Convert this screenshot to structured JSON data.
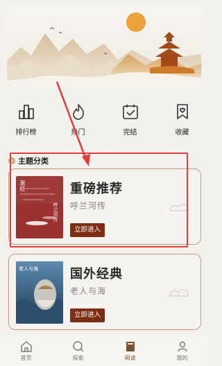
{
  "quick_nav": [
    {
      "label": "排行榜",
      "icon": "bar-chart-icon"
    },
    {
      "label": "热门",
      "icon": "flame-icon"
    },
    {
      "label": "完结",
      "icon": "calendar-check-icon"
    },
    {
      "label": "收藏",
      "icon": "bookmark-heart-icon"
    }
  ],
  "section": {
    "title": "主题分类"
  },
  "cards": [
    {
      "title": "重磅推荐",
      "subtitle": "呼兰河传",
      "cover_title": "呼兰河传",
      "cover_label": "萧红",
      "button": "立即进入"
    },
    {
      "title": "国外经典",
      "subtitle": "老人与海",
      "cover_title": "老人与海",
      "button": "立即进入"
    }
  ],
  "tabbar": [
    {
      "label": "首页",
      "icon": "home-icon",
      "active": false
    },
    {
      "label": "探索",
      "icon": "explore-icon",
      "active": false
    },
    {
      "label": "阅读",
      "icon": "book-icon",
      "active": true
    },
    {
      "label": "我的",
      "icon": "user-icon",
      "active": false
    }
  ],
  "colors": {
    "accent": "#7e2d12",
    "card_border": "#c69a73",
    "highlight": "#e23c3c",
    "sun": "#e8a038"
  }
}
